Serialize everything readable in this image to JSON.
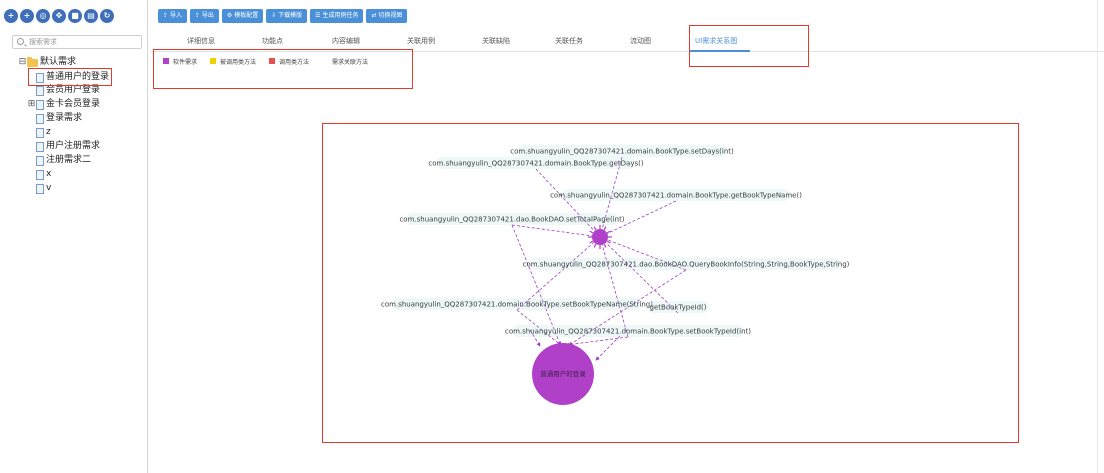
{
  "left_panel": {
    "toolbar_icons": [
      "plus-circle-icon",
      "add-icon",
      "add-child-icon",
      "move-icon",
      "delete-icon",
      "document-icon",
      "refresh-icon"
    ],
    "search_placeholder": "搜索需求",
    "tree": {
      "root": "默认需求",
      "items": [
        "普通用户的登录",
        "会员用户登录",
        "金卡会员登录",
        "登录需求",
        "z",
        "用户注册需求",
        "注册需求二",
        "x",
        "v"
      ]
    }
  },
  "toolbar": {
    "buttons": [
      "导入",
      "导出",
      "模板配置",
      "下载模版",
      "生成用例任务",
      "切换视图"
    ]
  },
  "tabs": {
    "items": [
      "详细信息",
      "功能点",
      "内容编辑",
      "关联用例",
      "关联缺陷",
      "关联任务",
      "流动图",
      "UI需求关系图"
    ],
    "active_index": 7
  },
  "legend": {
    "items": [
      {
        "label": "软件需求",
        "color": "#b040c8"
      },
      {
        "label": "被调用类方法",
        "color": "#f0d000"
      },
      {
        "label": "调用类方法",
        "color": "#e55050"
      },
      {
        "label": "需求关联方法",
        "color": "#a0d8e0"
      }
    ]
  },
  "graph": {
    "center_node_label": "普通用户的登录",
    "nodes": [
      "com.shuangyulin_QQ287307421.domain.BookType.setDays(int)",
      "com.shuangyulin_QQ287307421.domain.BookType.getDays()",
      "com.shuangyulin_QQ287307421.domain.BookType.getBookTypeName()",
      "com.shuangyulin_QQ287307421.dao.BookDAO.setTotalPage(int)",
      "com.shuangyulin_QQ287307421.dao.BookDAO.QueryBookInfo(String,String,BookType,String)",
      "com.shuangyulin_QQ287307421.domain.BookType.setBookTypeName(String)",
      "getBookTypeId()",
      "com.shuangyulin_QQ287307421.domain.BookType.setBookTypeId(int)"
    ],
    "colors": {
      "requirement": "#b040c8",
      "method_node": "#a0d8e0",
      "edge": "#9b3fc2"
    }
  }
}
